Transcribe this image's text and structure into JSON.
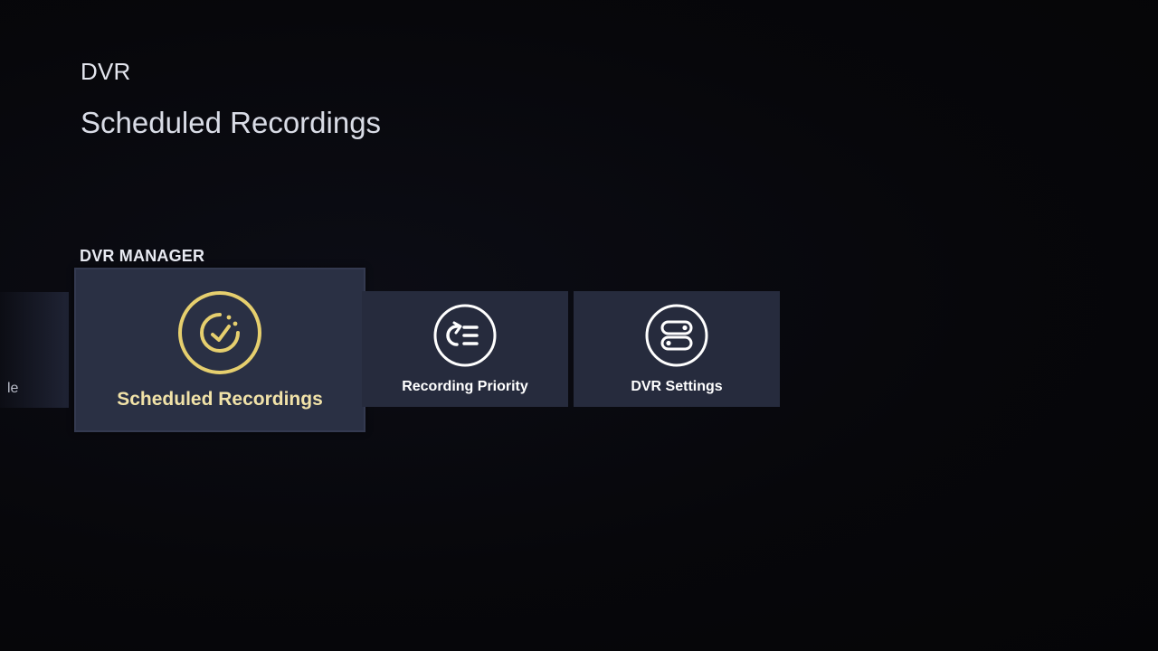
{
  "header": {
    "breadcrumb": "DVR",
    "title": "Scheduled Recordings"
  },
  "section": {
    "label": "DVR MANAGER"
  },
  "tiles": [
    {
      "label": "le",
      "icon": "unknown-icon",
      "state": "partial"
    },
    {
      "label": "Scheduled Recordings",
      "icon": "scheduled-clock-icon",
      "state": "focused"
    },
    {
      "label": "Recording Priority",
      "icon": "priority-list-icon",
      "state": "normal"
    },
    {
      "label": "DVR Settings",
      "icon": "settings-toggles-icon",
      "state": "normal"
    }
  ],
  "colors": {
    "background": "#060609",
    "tile": "#262b3d",
    "focus_accent": "#e6cf6e",
    "focus_text": "#f1e2a8"
  }
}
